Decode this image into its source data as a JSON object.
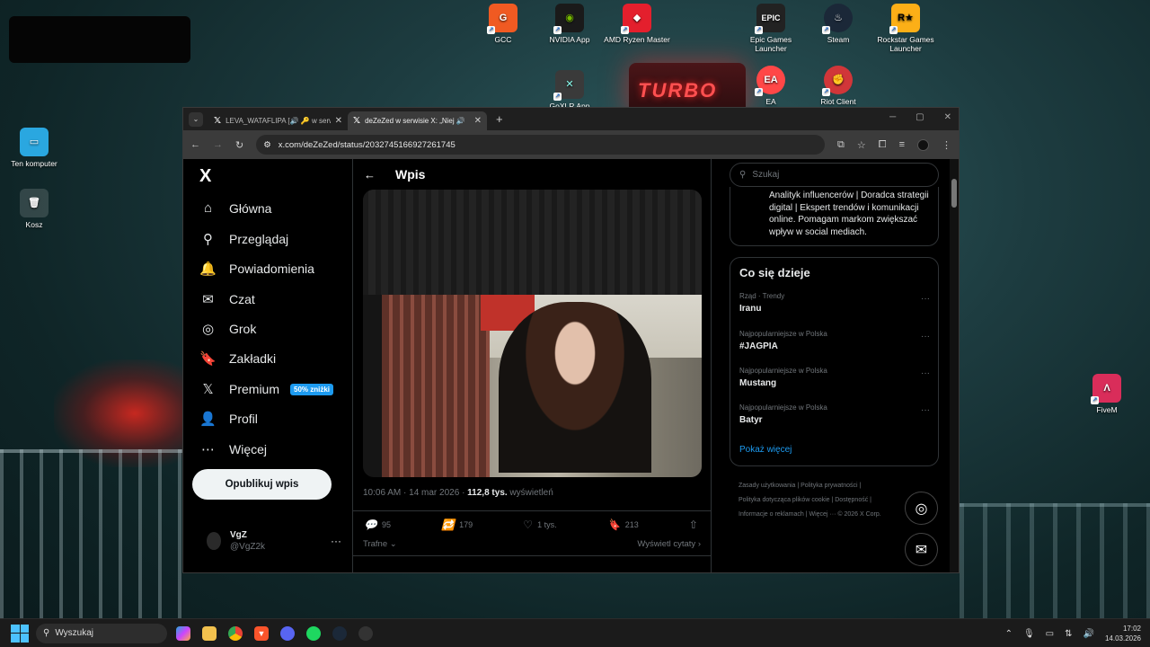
{
  "desktop": {
    "scene_sign_text": "TURBO",
    "icons": [
      {
        "label": "GCC",
        "color": "#f05a22",
        "glyph": "G"
      },
      {
        "label": "NVIDIA App",
        "color": "#76b900",
        "glyph": "◉"
      },
      {
        "label": "AMD Ryzen Master",
        "color": "#e41f2d",
        "glyph": "◆"
      },
      {
        "label": "Epic Games Launcher",
        "color": "#222222",
        "glyph": "EPIC"
      },
      {
        "label": "Steam",
        "color": "#1b2838",
        "glyph": "♨"
      },
      {
        "label": "Rockstar Games Launcher",
        "color": "#fcaf17",
        "glyph": "R★"
      },
      {
        "label": "GoXLR App",
        "color": "#3a3a3a",
        "glyph": "✕"
      },
      {
        "label": "EA",
        "color": "#ff4747",
        "glyph": "EA"
      },
      {
        "label": "Riot Client",
        "color": "#d13639",
        "glyph": "✊"
      },
      {
        "label": "Ten komputer",
        "color": "#2aa7e0",
        "glyph": "▭"
      },
      {
        "label": "Kosz",
        "color": "#7fb1d6",
        "glyph": "🗑"
      },
      {
        "label": "FiveM",
        "color": "#d92d5a",
        "glyph": "Λ"
      }
    ]
  },
  "browser": {
    "tabs": [
      {
        "label": "LEVA_WATAFLIPA [🔊 🔑 w serwisie X",
        "active": false
      },
      {
        "label": "deZeZed w serwisie X: „Niej 🔊",
        "active": true
      }
    ],
    "url": "x.com/deZeZed/status/2032745166927261745"
  },
  "nav": {
    "brand": "X",
    "items": [
      {
        "label": "Główna",
        "icon": "⌂"
      },
      {
        "label": "Przeglądaj",
        "icon": "⚲"
      },
      {
        "label": "Powiadomienia",
        "icon": "🔔"
      },
      {
        "label": "Czat",
        "icon": "✉"
      },
      {
        "label": "Grok",
        "icon": "◎"
      },
      {
        "label": "Zakładki",
        "icon": "🔖"
      },
      {
        "label": "Premium",
        "icon": "𝕏"
      },
      {
        "label": "Profil",
        "icon": "👤"
      },
      {
        "label": "Więcej",
        "icon": "⋯"
      }
    ],
    "premium_badge": "50% zniżki",
    "post_button": "Opublikuj wpis",
    "account": {
      "name": "VgZ",
      "handle": "@VgZ2k"
    }
  },
  "post": {
    "header": "Wpis",
    "timestamp": "10:06 AM · 14 mar 2026 · ",
    "views_count": "112,8 tys.",
    "views_label": " wyświetleń",
    "replies": "95",
    "reposts": "179",
    "likes": "1 tys.",
    "bookmarks": "213",
    "translate": "Trafne",
    "quotes": "Wyświetl cytaty"
  },
  "right": {
    "search_placeholder": "Szukaj",
    "bio": "Analityk influencerów | Doradca strategii digital | Ekspert trendów i komunikacji online. Pomagam markom zwiększać wpływ w social mediach.",
    "trends_title": "Co się dzieje",
    "trends": [
      {
        "context": "Rząd · Trendy",
        "name": "Iranu"
      },
      {
        "context": "Najpopularniejsze w Polska",
        "name": "#JAGPIA"
      },
      {
        "context": "Najpopularniejsze w Polska",
        "name": "Mustang"
      },
      {
        "context": "Najpopularniejsze w Polska",
        "name": "Batyr"
      }
    ],
    "show_more": "Pokaż więcej",
    "footer_lines": [
      "Zasady użytkowania  |  Polityka prywatności  |",
      "Polityka dotycząca plików cookie  |  Dostępność  |",
      "Informacje o reklamach  |  Więcej ···  © 2026 X Corp."
    ]
  },
  "taskbar": {
    "search_label": "Wyszukaj",
    "time": "17:02",
    "date": "14.03.2026"
  }
}
